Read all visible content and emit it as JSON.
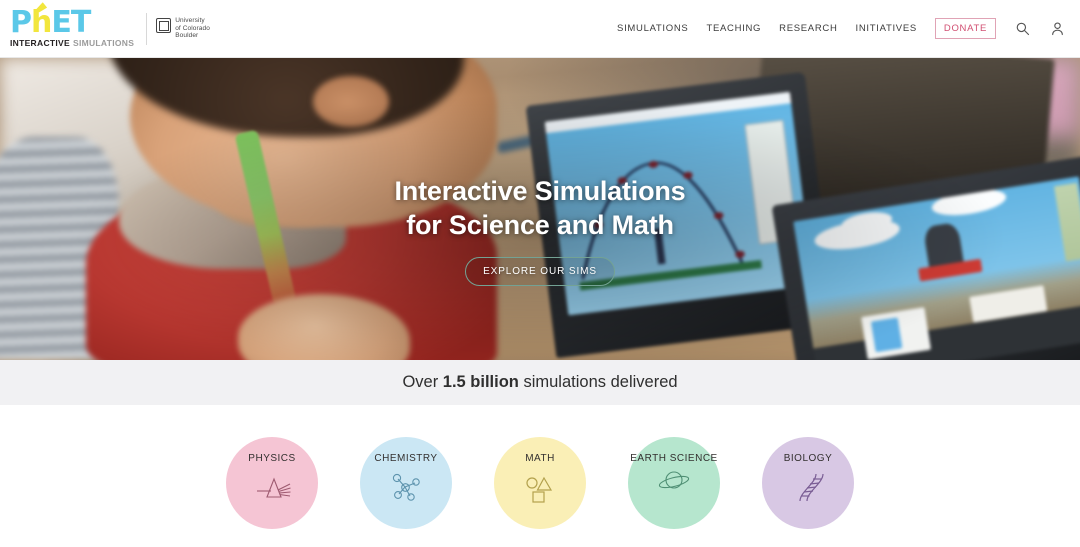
{
  "header": {
    "logo": {
      "p": "P",
      "h": "h",
      "et": "ET",
      "tagline_bold": "INTERACTIVE",
      "tagline_light": "SIMULATIONS",
      "icon": "phet-logo-icon"
    },
    "university": {
      "line1": "University",
      "line2": "of Colorado",
      "line3": "Boulder",
      "icon": "cu-boulder-logo-icon"
    },
    "nav": [
      {
        "label": "SIMULATIONS",
        "name": "nav-simulations"
      },
      {
        "label": "TEACHING",
        "name": "nav-teaching"
      },
      {
        "label": "RESEARCH",
        "name": "nav-research"
      },
      {
        "label": "INITIATIVES",
        "name": "nav-initiatives"
      }
    ],
    "donate_label": "DONATE",
    "donate_color": "#d14f72",
    "search_icon": "search-icon",
    "account_icon": "user-account-icon"
  },
  "hero": {
    "title_line1": "Interactive Simulations",
    "title_line2": "for Science and Math",
    "cta_label": "EXPLORE OUR SIMS",
    "cta_border_color": "#73a294"
  },
  "stats": {
    "prefix": "Over ",
    "highlight": "1.5 billion",
    "suffix": " simulations delivered",
    "background": "#f1f1f3"
  },
  "categories": [
    {
      "label": "PHYSICS",
      "name": "category-physics",
      "color": "#f5c5d4",
      "icon": "prism-icon",
      "icon_color": "#9e5a70"
    },
    {
      "label": "CHEMISTRY",
      "name": "category-chemistry",
      "color": "#cbe7f4",
      "icon": "molecule-icon",
      "icon_color": "#5d93ad"
    },
    {
      "label": "MATH",
      "name": "category-math",
      "color": "#faefb6",
      "icon": "shapes-icon",
      "icon_color": "#b3a14d"
    },
    {
      "label": "EARTH SCIENCE",
      "name": "category-earth-science",
      "color": "#b6e6ce",
      "icon": "planet-icon",
      "icon_color": "#4f8f74"
    },
    {
      "label": "BIOLOGY",
      "name": "category-biology",
      "color": "#d8c8e4",
      "icon": "dna-icon",
      "icon_color": "#7a5d94"
    }
  ]
}
